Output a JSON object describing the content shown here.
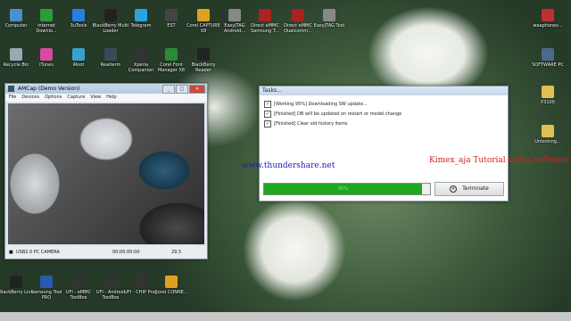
{
  "desktop_icons_top": [
    {
      "label": "Computer",
      "color": "#4a8fd0",
      "icon": "computer-icon"
    },
    {
      "label": "Internet Downlo...",
      "color": "#2d9b3a",
      "icon": "idm-icon"
    },
    {
      "label": "3uTools",
      "color": "#2a7ee0",
      "icon": "3utools-icon"
    },
    {
      "label": "BlackBerry Multi Loader",
      "color": "#222222",
      "icon": "blackberry-icon"
    },
    {
      "label": "Telegram",
      "color": "#2ba3e0",
      "icon": "telegram-icon"
    },
    {
      "label": "EST",
      "color": "#444444",
      "icon": "est-icon"
    },
    {
      "label": "Corel CAPTURE X8",
      "color": "#e0a020",
      "icon": "corel-icon"
    },
    {
      "label": "EasyJTAG Android...",
      "color": "#888888",
      "icon": "easyjtag-icon"
    },
    {
      "label": "Direct eMMC Samsung T...",
      "color": "#aa2222",
      "icon": "emmc-icon"
    },
    {
      "label": "Direct eMMC Qualcomm...",
      "color": "#aa2222",
      "icon": "emmc-icon"
    },
    {
      "label": "EasyJTAG Tool",
      "color": "#888888",
      "icon": "easyjtag-icon"
    }
  ],
  "desktop_icons_row2": [
    {
      "label": "Recycle Bin",
      "color": "#9aa8b5",
      "icon": "recycle-bin-icon"
    },
    {
      "label": "iTunes",
      "color": "#d84aa0",
      "icon": "itunes-icon"
    },
    {
      "label": "iRoot",
      "color": "#3aa0d0",
      "icon": "iroot-icon"
    },
    {
      "label": "Realterm",
      "color": "#3a4a5a",
      "icon": "realterm-icon"
    },
    {
      "label": "Xperia Companion",
      "color": "#333333",
      "icon": "xperia-icon"
    },
    {
      "label": "Corel Font Manager X8",
      "color": "#2a8a3a",
      "icon": "corel-font-icon"
    },
    {
      "label": "BlackBerry Reader",
      "color": "#222222",
      "icon": "blackberry-icon"
    }
  ],
  "desktop_icons_bottom": [
    {
      "label": "BlackBerry Link",
      "color": "#222222",
      "icon": "blackberry-icon"
    },
    {
      "label": "Samsung Tool PRO",
      "color": "#2a5ab0",
      "icon": "samsung-tool-icon"
    },
    {
      "label": "UFI - eMMC ToolBox",
      "color": "#333333",
      "icon": "ufi-icon"
    },
    {
      "label": "UFI - Android ToolBox",
      "color": "#333333",
      "icon": "ufi-icon"
    },
    {
      "label": "UFI - CHIP Prog",
      "color": "#333333",
      "icon": "ufi-icon"
    },
    {
      "label": "Corel CONNE...",
      "color": "#e0a020",
      "icon": "corel-icon"
    }
  ],
  "desktop_icons_right": [
    {
      "label": "weaphones...",
      "color": "#c03030",
      "icon": "pdf-icon"
    },
    {
      "label": "SOFTWARE PC",
      "color": "#4a6a8a",
      "icon": "folder-icon"
    },
    {
      "label": "P3100",
      "color": "#e0c050",
      "icon": "folder-icon"
    },
    {
      "label": "Unlocking...",
      "color": "#e0c050",
      "icon": "folder-icon"
    }
  ],
  "amcap": {
    "title": "AMCap (Demo Version)",
    "menu": [
      "File",
      "Devices",
      "Options",
      "Capture",
      "View",
      "Help"
    ],
    "status_camera": "USB2.0 PC CAMERA",
    "status_time": "00:00:00:00",
    "status_fps": "29.5",
    "win_min": "_",
    "win_max": "□",
    "win_close": "✕"
  },
  "tasks": {
    "title": "Tasks...",
    "items": [
      "[Working 95%] Downloading SW update...",
      "[Finished] DB will be updated on restart or model change",
      "[Finished] Clear old history items"
    ],
    "progress_percent": 95,
    "progress_label": "95%",
    "terminate_label": "Terminate"
  },
  "overlay": {
    "url": "www.thundershare.net",
    "tutorial": "Kimex_aja Tutorial soeya software"
  }
}
